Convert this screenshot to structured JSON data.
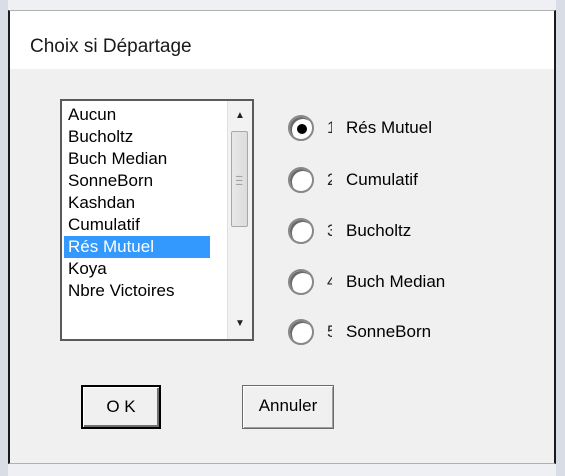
{
  "dialog": {
    "title": "Choix si Départage"
  },
  "listbox": {
    "items": [
      "Aucun",
      "Bucholtz",
      "Buch Median",
      "SonneBorn",
      "Kashdan",
      "Cumulatif",
      "Rés Mutuel",
      "Koya",
      "Nbre Victoires"
    ],
    "selected": "Rés Mutuel",
    "selected_color": "#3399ff"
  },
  "tiebreaks": [
    {
      "digit": "1",
      "label": "Rés Mutuel",
      "checked": true
    },
    {
      "digit": "2",
      "label": "Cumulatif",
      "checked": false
    },
    {
      "digit": "3",
      "label": "Bucholtz",
      "checked": false
    },
    {
      "digit": "4",
      "label": "Buch Median",
      "checked": false
    },
    {
      "digit": "5",
      "label": "SonneBorn",
      "checked": false
    }
  ],
  "buttons": {
    "ok_label": "O K",
    "cancel_label": "Annuler"
  },
  "icons": {
    "scroll_up": "scroll-up-arrow-icon",
    "scroll_down": "scroll-down-arrow-icon",
    "scroll_grip": "scroll-grip-icon"
  }
}
